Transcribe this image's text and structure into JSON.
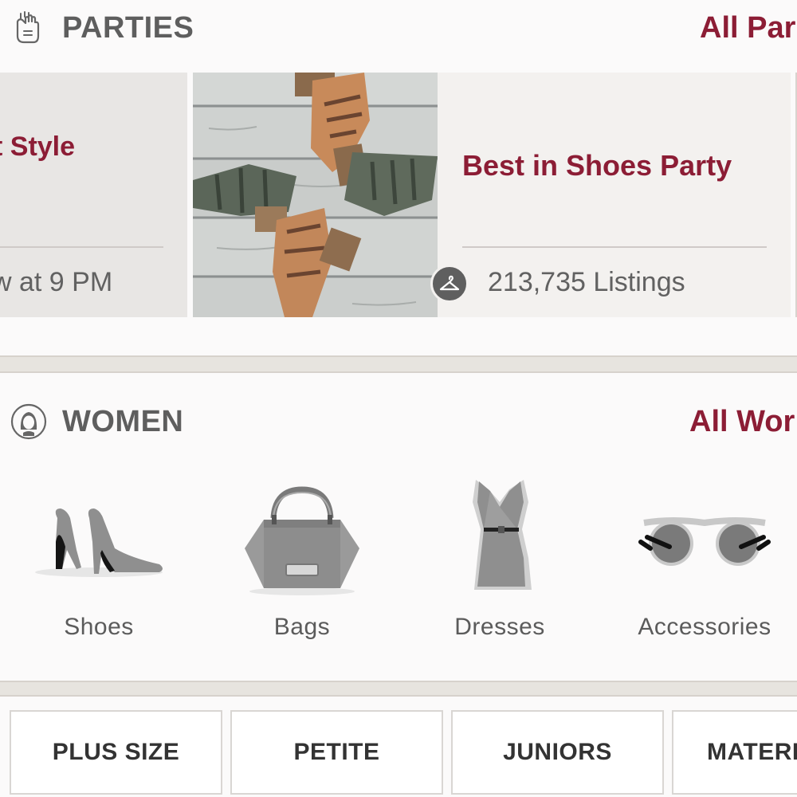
{
  "parties": {
    "title": "PARTIES",
    "all_link": "All Par",
    "cards": [
      {
        "title": "t Style",
        "meta": "w at 9 PM"
      },
      {
        "title": "Best in Shoes Party",
        "meta": "213,735 Listings"
      }
    ]
  },
  "women": {
    "title": "WOMEN",
    "all_link": "All Wor",
    "categories": [
      {
        "label": "Shoes",
        "icon": "heels-icon"
      },
      {
        "label": "Bags",
        "icon": "handbag-icon"
      },
      {
        "label": "Dresses",
        "icon": "dress-icon"
      },
      {
        "label": "Accessories",
        "icon": "sunglasses-icon"
      }
    ]
  },
  "sizes": [
    "PLUS SIZE",
    "PETITE",
    "JUNIORS",
    "MATERI"
  ],
  "colors": {
    "accent": "#8c1d35",
    "text": "#5e5e5e",
    "background": "#fbfafa",
    "band": "#e7e4df"
  }
}
